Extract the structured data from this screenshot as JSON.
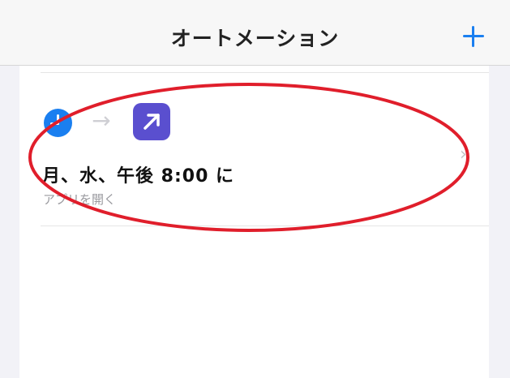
{
  "navbar": {
    "title": "オートメーション",
    "add_icon": "plus-icon"
  },
  "automation": {
    "trigger_icon": "clock-icon",
    "arrow_icon": "arrow-right-icon",
    "action_icon": "open-app-icon",
    "title": "月、水、午後 8:00 に",
    "subtitle": "アプリを開く",
    "chevron_icon": "chevron-right-icon"
  },
  "colors": {
    "accent": "#1a7ff0",
    "app_icon": "#5a4fcf",
    "highlight": "#e01e2b"
  }
}
